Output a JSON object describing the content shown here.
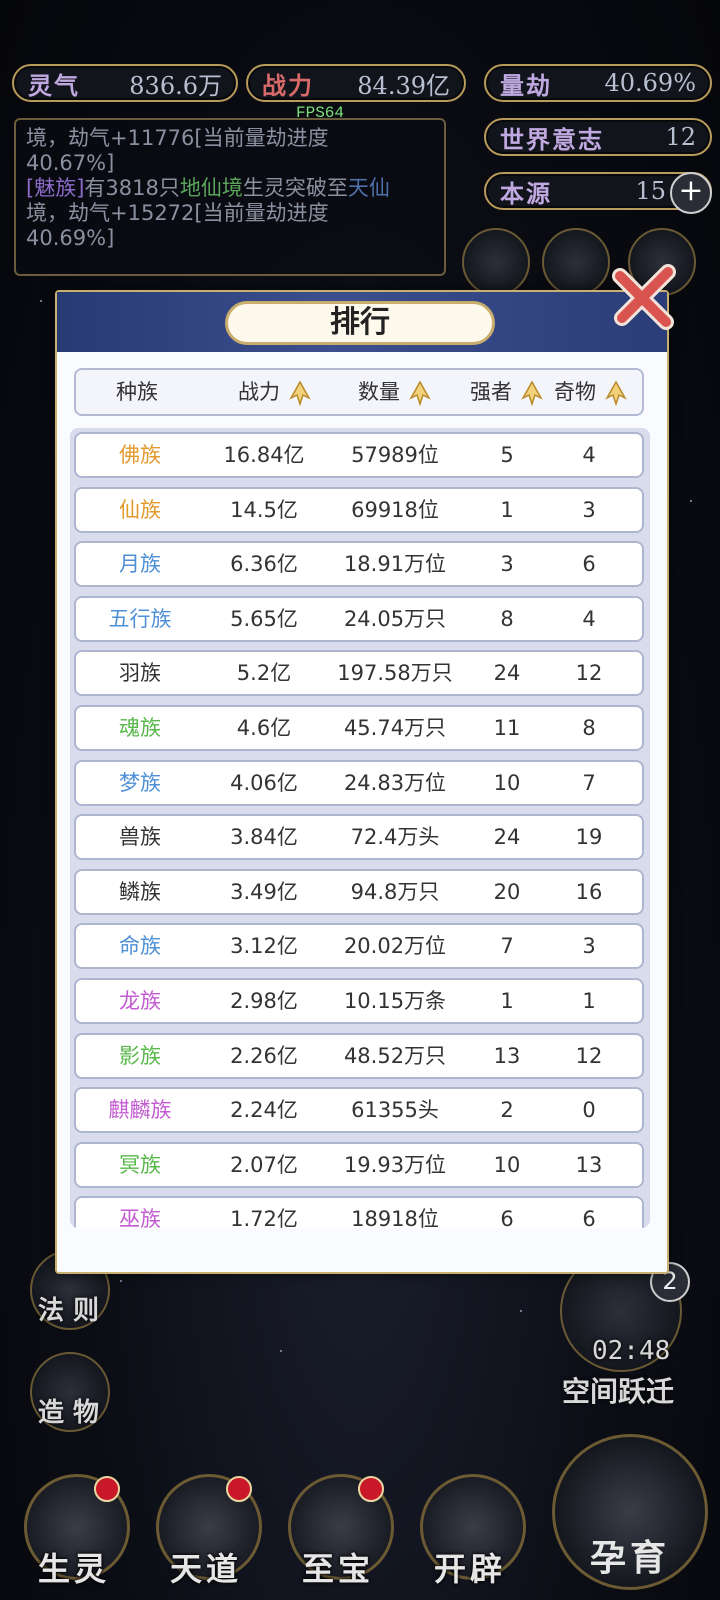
{
  "stats": {
    "lingqi": {
      "label": "灵气",
      "value": "836.6万"
    },
    "zhanli": {
      "label": "战力",
      "value": "84.39亿"
    },
    "liangjie": {
      "label": "量劫",
      "value": "40.69%"
    },
    "world_will": {
      "label": "世界意志",
      "value": "12"
    },
    "benyuan": {
      "label": "本源",
      "value": "15",
      "plus": "+"
    }
  },
  "fps": "FPS64",
  "log": {
    "line1": "境，劫气+11776[当前量劫进度",
    "line2": "40.67%]",
    "line3_race": "[魅族]",
    "line3_mid": "有3818只",
    "line3_realm": "地仙境",
    "line3_tail": "生灵突破至",
    "line3_target": "天仙",
    "line4": "境，劫气+15272[当前量劫进度",
    "line5": "40.69%]"
  },
  "side": {
    "fa_ze": "法 则",
    "zao_wu": "造 物",
    "timer": "02:48",
    "space_jump": "空间跃迁",
    "badge": "2"
  },
  "bottom_nav": [
    {
      "label": "生灵",
      "dot": true
    },
    {
      "label": "天道",
      "dot": true
    },
    {
      "label": "至宝",
      "dot": true
    },
    {
      "label": "开辟",
      "dot": false
    }
  ],
  "yun_yu": "孕育",
  "modal": {
    "title": "排行",
    "headers": {
      "race": "种族",
      "power": "战力",
      "count": "数量",
      "strong": "强者",
      "wonder": "奇物"
    },
    "colors": {
      "orange": "#e39a2d",
      "blue": "#4e8fd6",
      "green": "#58b84a",
      "purple": "#c25bd1",
      "black": "#333333"
    },
    "rows": [
      {
        "race": "佛族",
        "color": "orange",
        "power": "16.84亿",
        "count": "57989位",
        "strong": "5",
        "wonder": "4"
      },
      {
        "race": "仙族",
        "color": "orange",
        "power": "14.5亿",
        "count": "69918位",
        "strong": "1",
        "wonder": "3"
      },
      {
        "race": "月族",
        "color": "blue",
        "power": "6.36亿",
        "count": "18.91万位",
        "strong": "3",
        "wonder": "6"
      },
      {
        "race": "五行族",
        "color": "blue",
        "power": "5.65亿",
        "count": "24.05万只",
        "strong": "8",
        "wonder": "4"
      },
      {
        "race": "羽族",
        "color": "black",
        "power": "5.2亿",
        "count": "197.58万只",
        "strong": "24",
        "wonder": "12"
      },
      {
        "race": "魂族",
        "color": "green",
        "power": "4.6亿",
        "count": "45.74万只",
        "strong": "11",
        "wonder": "8"
      },
      {
        "race": "梦族",
        "color": "blue",
        "power": "4.06亿",
        "count": "24.83万位",
        "strong": "10",
        "wonder": "7"
      },
      {
        "race": "兽族",
        "color": "black",
        "power": "3.84亿",
        "count": "72.4万头",
        "strong": "24",
        "wonder": "19"
      },
      {
        "race": "鳞族",
        "color": "black",
        "power": "3.49亿",
        "count": "94.8万只",
        "strong": "20",
        "wonder": "16"
      },
      {
        "race": "命族",
        "color": "blue",
        "power": "3.12亿",
        "count": "20.02万位",
        "strong": "7",
        "wonder": "3"
      },
      {
        "race": "龙族",
        "color": "purple",
        "power": "2.98亿",
        "count": "10.15万条",
        "strong": "1",
        "wonder": "1"
      },
      {
        "race": "影族",
        "color": "green",
        "power": "2.26亿",
        "count": "48.52万只",
        "strong": "13",
        "wonder": "12"
      },
      {
        "race": "麒麟族",
        "color": "purple",
        "power": "2.24亿",
        "count": "61355头",
        "strong": "2",
        "wonder": "0"
      },
      {
        "race": "冥族",
        "color": "green",
        "power": "2.07亿",
        "count": "19.93万位",
        "strong": "10",
        "wonder": "13"
      },
      {
        "race": "巫族",
        "color": "purple",
        "power": "1.72亿",
        "count": "18918位",
        "strong": "6",
        "wonder": "6"
      }
    ]
  }
}
